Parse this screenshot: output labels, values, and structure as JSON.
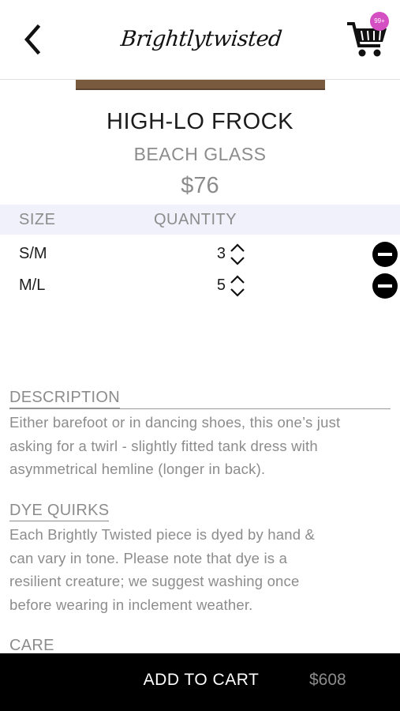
{
  "header": {
    "logo_text": "Brightlytwisted",
    "cart_badge": "99+",
    "back_icon": "chevron-left-icon",
    "cart_icon": "shopping-cart-icon"
  },
  "product": {
    "name": "HIGH-LO FROCK",
    "color": "BEACH GLASS",
    "price": "$76"
  },
  "size_table": {
    "headers": {
      "size": "SIZE",
      "quantity": "QUANTITY"
    },
    "rows": [
      {
        "size": "S/M",
        "quantity": "3"
      },
      {
        "size": "M/L",
        "quantity": "5"
      }
    ]
  },
  "sections": {
    "description": {
      "heading": "DESCRIPTION",
      "lines": [
        "Either barefoot or in dancing shoes, this one’s just",
        "asking for a twirl - slightly fitted tank dress with",
        "asymmetrical hemline (longer in back)."
      ]
    },
    "dye_quirks": {
      "heading": "DYE QUIRKS",
      "lines": [
        "Each Brightly Twisted piece is dyed by hand &",
        "can vary in tone.  Please note that dye is a",
        "resilient creature; we suggest washing once",
        "before wearing in inclement weather."
      ]
    },
    "care": {
      "heading": "CARE"
    }
  },
  "bottom_bar": {
    "add_to_cart_label": "ADD TO CART",
    "total": "$608"
  },
  "colors": {
    "badge": "#d44fc2",
    "table_header_bg": "#f1f1fb",
    "muted_text": "#8c8c8c",
    "bottom_bar_bg": "#000000"
  }
}
